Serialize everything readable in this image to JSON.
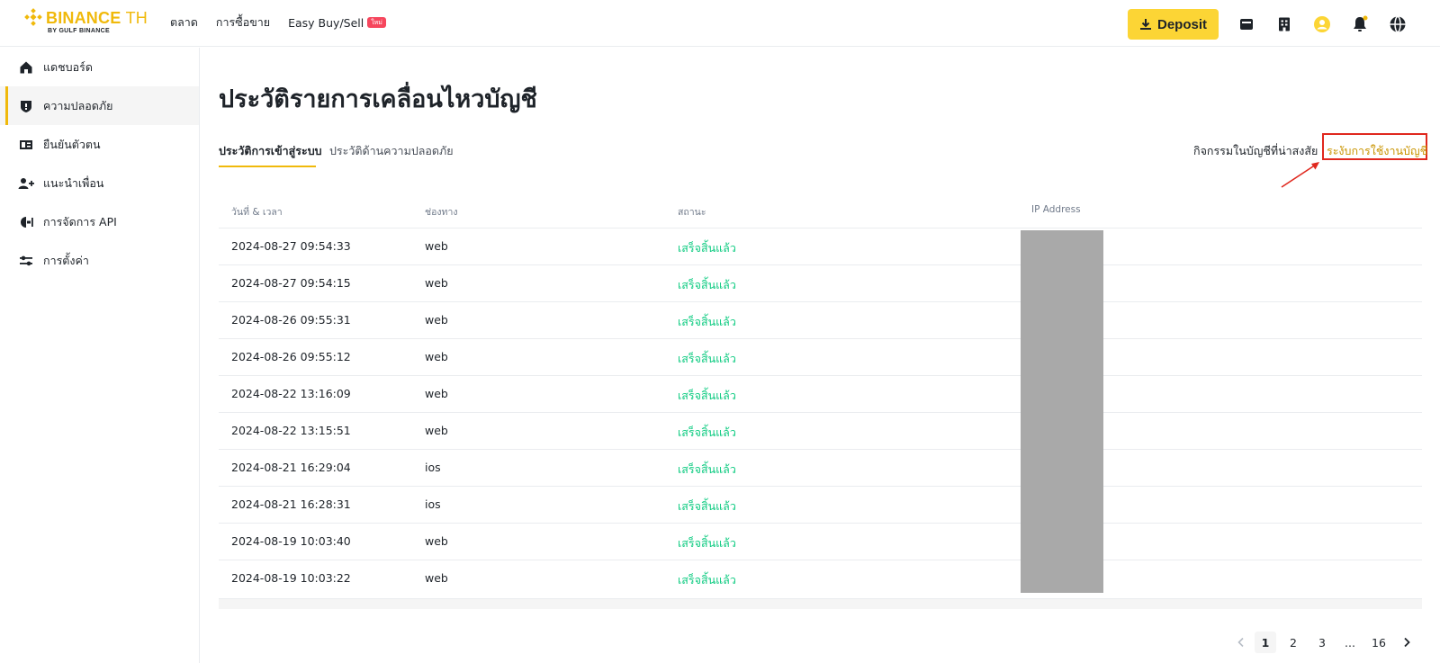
{
  "brand": {
    "name": "BINANCE",
    "suffix": "TH",
    "sub": "BY GULF BINANCE",
    "color": "#f0b90b"
  },
  "header": {
    "nav": [
      {
        "label": "ตลาด"
      },
      {
        "label": "การซื้อขาย"
      },
      {
        "label": "Easy Buy/Sell",
        "badge": "ใหม่"
      }
    ],
    "deposit_label": "Deposit",
    "icons": [
      "wallet-icon",
      "orders-icon",
      "profile-icon",
      "notification-icon",
      "globe-icon"
    ]
  },
  "sidebar": {
    "items": [
      {
        "label": "แดชบอร์ด",
        "icon": "home-icon"
      },
      {
        "label": "ความปลอดภัย",
        "icon": "shield-icon",
        "active": true
      },
      {
        "label": "ยืนยันตัวตน",
        "icon": "id-card-icon"
      },
      {
        "label": "แนะนำเพื่อน",
        "icon": "add-user-icon"
      },
      {
        "label": "การจัดการ API",
        "icon": "api-icon"
      },
      {
        "label": "การตั้งค่า",
        "icon": "settings-icon"
      }
    ]
  },
  "main": {
    "title": "ประวัติรายการเคลื่อนไหวบัญชี",
    "tabs": [
      {
        "label": "ประวัติการเข้าสู่ระบบ",
        "active": true
      },
      {
        "label": "ประวัติด้านความปลอดภัย"
      }
    ],
    "suspicious_link": "กิจกรรมในบัญชีที่น่าสงสัย",
    "freeze_link": "ระงับการใช้งานบัญชี"
  },
  "table": {
    "headers": [
      "วันที่ & เวลา",
      "ช่องทาง",
      "สถานะ",
      "IP Address"
    ],
    "rows": [
      {
        "datetime": "2024-08-27 09:54:33",
        "channel": "web",
        "status": "เสร็จสิ้นแล้ว"
      },
      {
        "datetime": "2024-08-27 09:54:15",
        "channel": "web",
        "status": "เสร็จสิ้นแล้ว"
      },
      {
        "datetime": "2024-08-26 09:55:31",
        "channel": "web",
        "status": "เสร็จสิ้นแล้ว"
      },
      {
        "datetime": "2024-08-26 09:55:12",
        "channel": "web",
        "status": "เสร็จสิ้นแล้ว"
      },
      {
        "datetime": "2024-08-22 13:16:09",
        "channel": "web",
        "status": "เสร็จสิ้นแล้ว"
      },
      {
        "datetime": "2024-08-22 13:15:51",
        "channel": "web",
        "status": "เสร็จสิ้นแล้ว"
      },
      {
        "datetime": "2024-08-21 16:29:04",
        "channel": "ios",
        "status": "เสร็จสิ้นแล้ว"
      },
      {
        "datetime": "2024-08-21 16:28:31",
        "channel": "ios",
        "status": "เสร็จสิ้นแล้ว"
      },
      {
        "datetime": "2024-08-19 10:03:40",
        "channel": "web",
        "status": "เสร็จสิ้นแล้ว"
      },
      {
        "datetime": "2024-08-19 10:03:22",
        "channel": "web",
        "status": "เสร็จสิ้นแล้ว"
      }
    ]
  },
  "pagination": {
    "pages": [
      "1",
      "2",
      "3",
      "...",
      "16"
    ],
    "current": "1"
  },
  "colors": {
    "accent": "#fcd535",
    "success": "#0ecb81",
    "highlight_box": "#e0281e"
  }
}
